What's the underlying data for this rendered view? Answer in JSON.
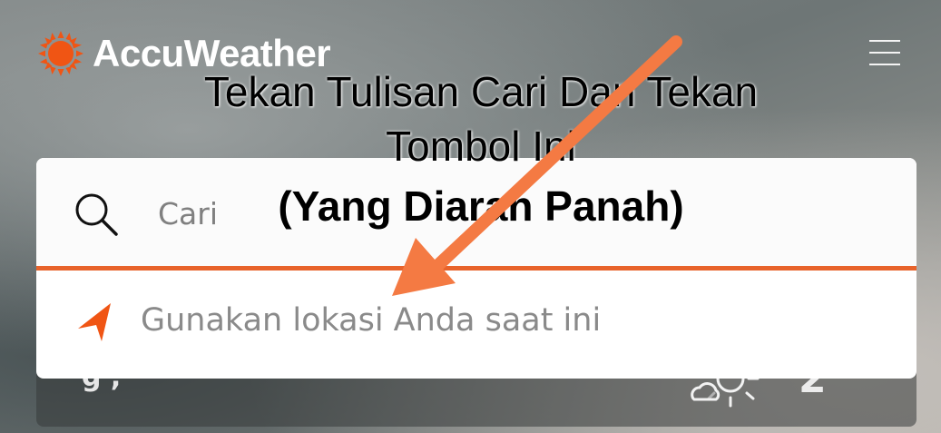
{
  "header": {
    "brand": "AccuWeather",
    "brand_color": "#f05514",
    "logo_icon": "sun-icon",
    "menu_icon": "hamburger-menu-icon"
  },
  "search": {
    "icon": "search-icon",
    "placeholder": "Cari",
    "value": "",
    "accent_color": "#e8632b"
  },
  "location": {
    "icon": "location-arrow-icon",
    "label": "Gunakan lokasi Anda saat ini"
  },
  "background_card": {
    "partial_text": "g  ,",
    "weather_icon": "partly-sunny-icon",
    "temp_partial": "2°"
  },
  "annotation": {
    "line1": "Tekan Tulisan Cari Dan Tekan",
    "line2": "Tombol Ini",
    "line3": "(Yang Diarah Panah)",
    "arrow_color": "#f47a43"
  }
}
